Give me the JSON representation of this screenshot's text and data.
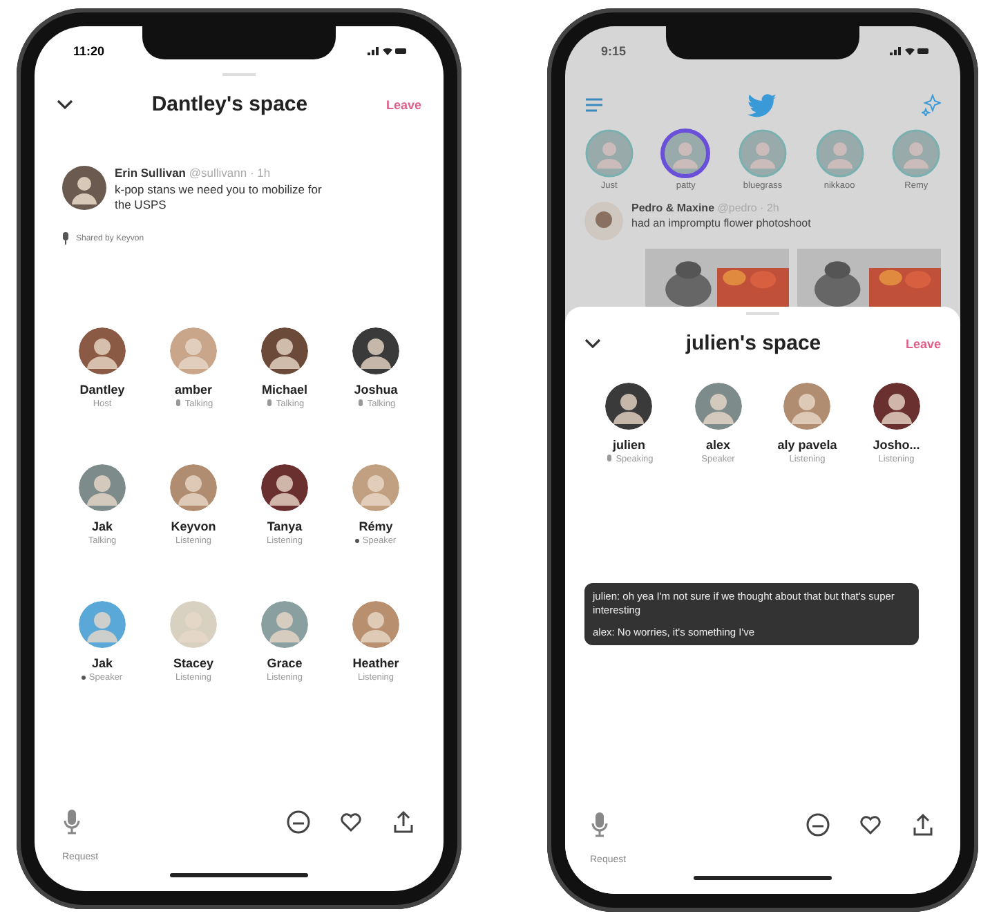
{
  "phones": [
    {
      "kind": "space",
      "status_time": "11:20",
      "title": "Dantley's space",
      "leave": "Leave",
      "tweet": {
        "author": "Erin Sullivan",
        "handle": "@sullivann · 1h",
        "text": "k-pop stans we need you to mobilize for the USPS"
      },
      "shared_by": "Shared by Keyvon",
      "people": [
        {
          "name": "Dantley",
          "status": "Host"
        },
        {
          "name": "amber",
          "status": "Talking",
          "kind": "mic"
        },
        {
          "name": "Michael",
          "status": "Talking",
          "kind": "mic"
        },
        {
          "name": "Joshua",
          "status": "Talking",
          "kind": "mic"
        },
        {
          "name": "Jak",
          "status": "Talking"
        },
        {
          "name": "Keyvon",
          "status": "Listening"
        },
        {
          "name": "Tanya",
          "status": "Listening"
        },
        {
          "name": "Rémy",
          "status": "Speaker",
          "kind": "dot"
        },
        {
          "name": "Jak",
          "status": "Speaker",
          "kind": "dot"
        },
        {
          "name": "Stacey",
          "status": "Listening"
        },
        {
          "name": "Grace",
          "status": "Listening"
        },
        {
          "name": "Heather",
          "status": "Listening"
        }
      ],
      "request": "Request"
    },
    {
      "kind": "home",
      "status_time": "9:15",
      "fleets": [
        {
          "name": "Just",
          "live": false
        },
        {
          "name": "patty",
          "live": true
        },
        {
          "name": "bluegrass",
          "live": false
        },
        {
          "name": "nikkaoo",
          "live": false
        },
        {
          "name": "Remy",
          "live": false
        }
      ],
      "tweet": {
        "author": "Pedro & Maxine",
        "handle": "@pedro · 2h",
        "text": "had an impromptu flower photoshoot"
      },
      "title": "julien's space",
      "leave": "Leave",
      "people": [
        {
          "name": "julien",
          "status": "Speaking",
          "kind": "mic"
        },
        {
          "name": "alex",
          "status": "Speaker"
        },
        {
          "name": "aly pavela",
          "status": "Listening"
        },
        {
          "name": "Josho...",
          "status": "Listening"
        }
      ],
      "captions": [
        "julien: oh yea I'm not sure if we thought about that but that's super interesting",
        "alex: No worries, it's something I've"
      ],
      "request": "Request"
    }
  ]
}
